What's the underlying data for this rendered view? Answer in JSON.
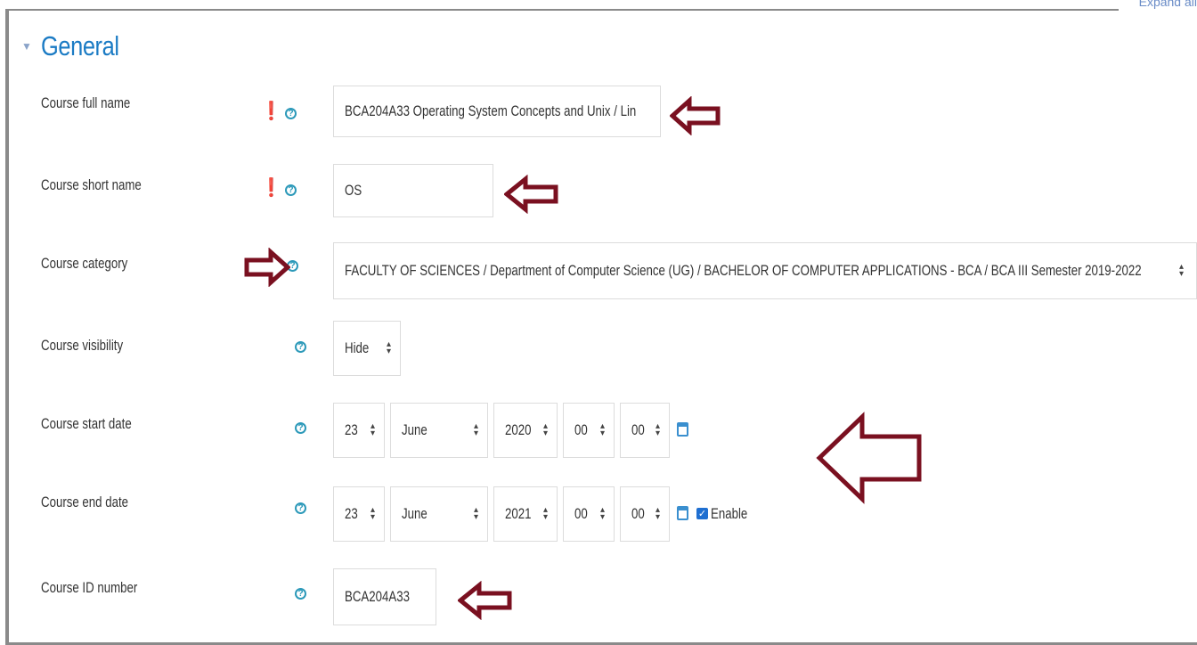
{
  "header": {
    "expand_all": "Expand all"
  },
  "section": {
    "title": "General"
  },
  "fields": {
    "full_name": {
      "label": "Course full name",
      "value": "BCA204A33 Operating System Concepts and Unix / Lin"
    },
    "short_name": {
      "label": "Course short name",
      "value": "OS"
    },
    "category": {
      "label": "Course category",
      "value": "FACULTY OF SCIENCES / Department of Computer Science (UG) / BACHELOR OF COMPUTER APPLICATIONS - BCA / BCA III Semester 2019-2022"
    },
    "visibility": {
      "label": "Course visibility",
      "value": "Hide"
    },
    "start_date": {
      "label": "Course start date",
      "day": "23",
      "month": "June",
      "year": "2020",
      "hour": "00",
      "minute": "00"
    },
    "end_date": {
      "label": "Course end date",
      "day": "23",
      "month": "June",
      "year": "2021",
      "hour": "00",
      "minute": "00",
      "enable_label": "Enable",
      "enabled": true
    },
    "id_number": {
      "label": "Course ID number",
      "value": "BCA204A33"
    }
  },
  "icons": {
    "required": "exclamation-circle-icon",
    "help": "question-circle-icon",
    "calendar": "calendar-icon",
    "annotation": "outline-arrow-icon"
  },
  "colors": {
    "section_title": "#1b7bc4",
    "required": "#cc0000",
    "help": "#2c99b9",
    "annotation_arrow": "#7a1020",
    "checkbox": "#1f6fd1"
  }
}
